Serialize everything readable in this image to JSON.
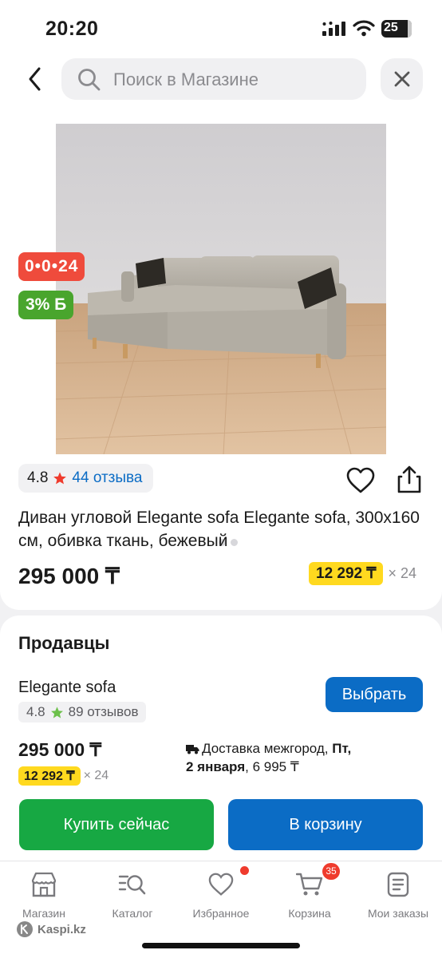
{
  "status_bar": {
    "time": "20:20",
    "battery": "25"
  },
  "header": {
    "search_placeholder": "Поиск в Магазине"
  },
  "product": {
    "badges": {
      "timer": "0•0•24",
      "bonus": "3% Б"
    },
    "rating": {
      "value": "4.8",
      "reviews": "44 отзыва"
    },
    "title": "Диван угловой Elegante sofa Elegante sofa, 300x160 см, обивка ткань, бежевый",
    "price": "295 000 ₸",
    "installment": {
      "amount": "12 292 ₸",
      "months": "× 24"
    },
    "gallery": {
      "total_images": 3,
      "active_index": 0
    }
  },
  "sellers": {
    "heading": "Продавцы",
    "items": [
      {
        "name": "Elegante sofa",
        "rating": "4.8",
        "reviews": "89 отзывов",
        "choose_label": "Выбрать",
        "price": "295 000 ₸",
        "installment": {
          "amount": "12 292 ₸",
          "months": "× 24"
        },
        "delivery": {
          "prefix": "Доставка межгород, ",
          "day": "Пт,",
          "date": "2 января",
          "cost": ", 6 995 ₸"
        }
      }
    ],
    "buy_now_label": "Купить сейчас",
    "add_to_cart_label": "В корзину"
  },
  "tabbar": {
    "items": [
      {
        "label": "Магазин",
        "icon": "shop-icon"
      },
      {
        "label": "Каталог",
        "icon": "catalog-search-icon"
      },
      {
        "label": "Избранное",
        "icon": "heart-icon"
      },
      {
        "label": "Корзина",
        "icon": "cart-icon"
      },
      {
        "label": "Мои заказы",
        "icon": "orders-icon"
      }
    ],
    "cart_count": "35"
  },
  "watermark": "Kaspi.kz",
  "colors": {
    "primary_blue": "#0b6cc5",
    "buy_green": "#17a843",
    "badge_red": "#ef4b3c",
    "installment_yellow": "#ffd91f"
  }
}
